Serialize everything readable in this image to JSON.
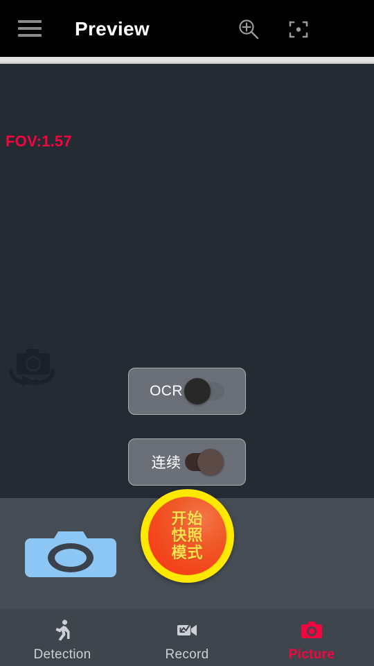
{
  "header": {
    "title": "Preview",
    "menu_icon": "hamburger-menu-icon",
    "zoom_icon": "zoom-in-icon",
    "focus_icon": "focus-frame-icon"
  },
  "preview": {
    "fov_label": "FOV:1.57",
    "switch_camera_icon": "switch-camera-icon",
    "toggles": [
      {
        "label": "OCR",
        "state": "off",
        "name": "ocr-toggle"
      },
      {
        "label": "连续",
        "state": "on",
        "name": "continuous-toggle"
      }
    ]
  },
  "capture": {
    "gallery_icon": "camera-thumbnail-icon",
    "shutter_lines": [
      "开始",
      "快照",
      "模式"
    ]
  },
  "bottom_nav": {
    "items": [
      {
        "label": "Detection",
        "icon": "running-person-icon",
        "active": false
      },
      {
        "label": "Record",
        "icon": "video-camera-icon",
        "active": false
      },
      {
        "label": "Picture",
        "icon": "photo-camera-icon",
        "active": true
      }
    ]
  },
  "colors": {
    "accent": "#f5053f",
    "header_bg": "#000000",
    "preview_bg": "#242b33",
    "bar_bg": "#454c54",
    "nav_bg": "#3e454c",
    "shutter_ring": "#ffe800",
    "shutter_fill": "#f05a28",
    "shutter_text": "#ffe14f",
    "thumb_camera": "#8cc6f5"
  }
}
